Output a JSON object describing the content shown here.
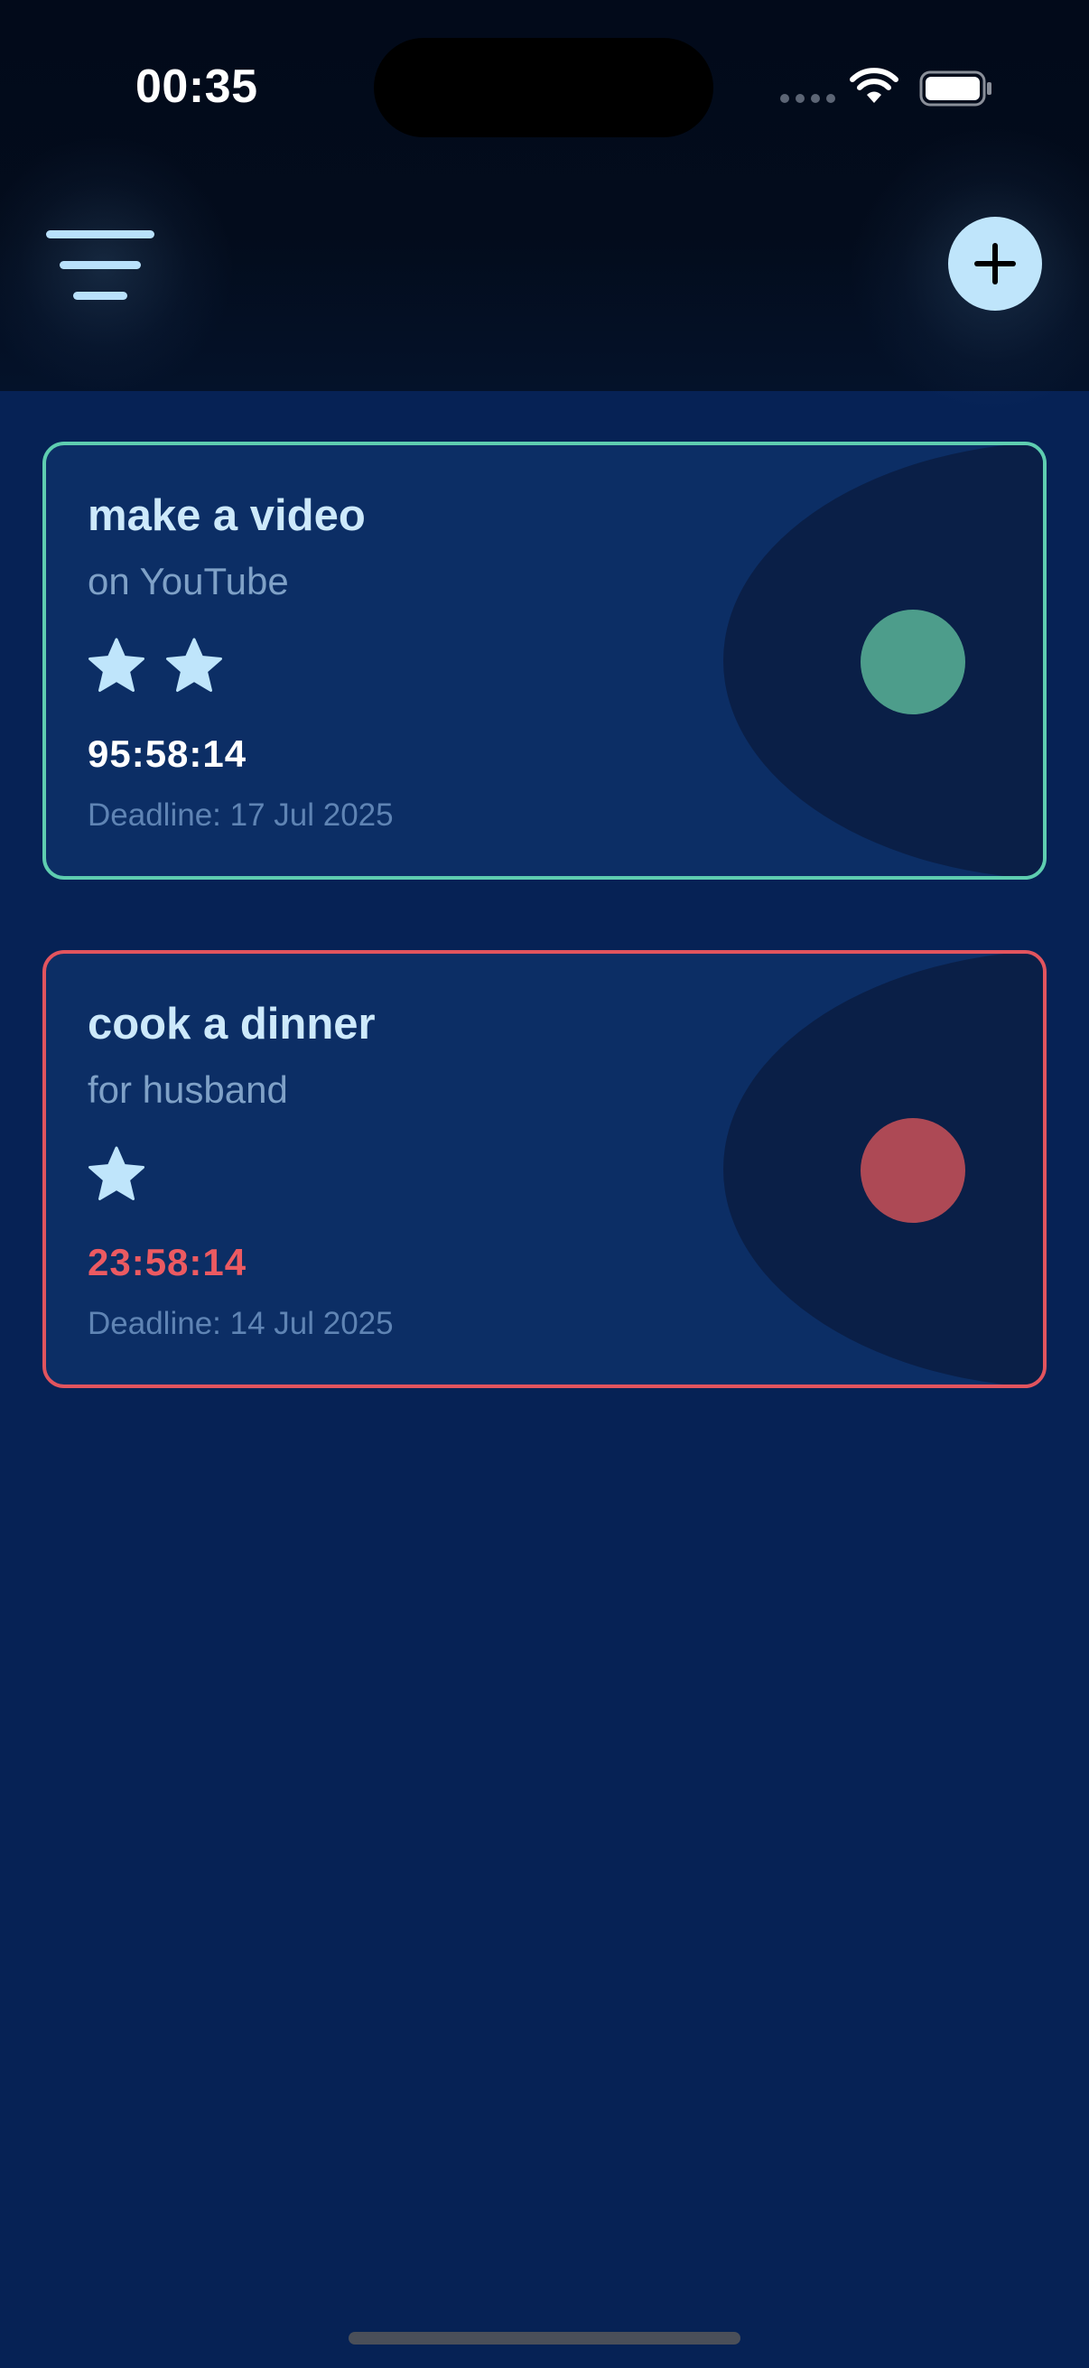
{
  "status_bar": {
    "time": "00:35",
    "icons": [
      "cellular-signal-icon",
      "wifi-icon",
      "battery-icon"
    ]
  },
  "header": {
    "menu_icon": "menu-lines-icon",
    "add_icon": "plus-icon"
  },
  "colors": {
    "background": "#062255",
    "card_background": "#0c2e65",
    "accent_green": "#5ecdb0",
    "accent_red": "#e2545e",
    "text_primary": "#cde9fb",
    "button_light": "#bfe5fb"
  },
  "tasks": [
    {
      "title": "make a video",
      "subtitle": "on YouTube",
      "stars": 2,
      "timer": "95:58:14",
      "deadline": "Deadline: 17 Jul 2025",
      "status_color": "#4d9d8b",
      "border_color": "#5ecdb0"
    },
    {
      "title": "cook a dinner",
      "subtitle": "for husband",
      "stars": 1,
      "timer": "23:58:14",
      "deadline": "Deadline: 14 Jul 2025",
      "status_color": "#ad4955",
      "border_color": "#e2545e"
    }
  ]
}
